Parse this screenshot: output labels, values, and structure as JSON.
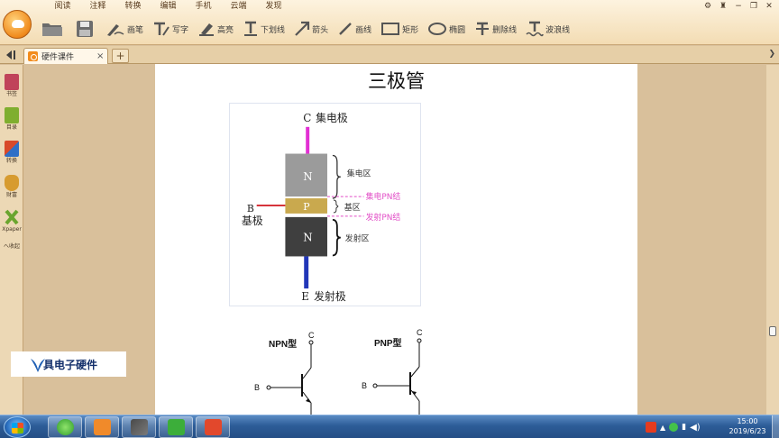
{
  "menu": [
    "阅读",
    "注释",
    "转换",
    "编辑",
    "手机",
    "云端",
    "发现"
  ],
  "toolbar": {
    "pen": "画笔",
    "write": "写字",
    "highlight": "高亮",
    "underline": "下划线",
    "arrow": "箭头",
    "curve": "画线",
    "rectangle": "矩形",
    "ellipse": "椭圆",
    "strikethrough": "删除线",
    "wavyline": "波浪线"
  },
  "tab": {
    "label": "硬件课件"
  },
  "sidebar": {
    "bookmark": "书签",
    "toc": "目录",
    "convert": "转换",
    "wealth": "财富",
    "xpaper": "Xpaper",
    "collapse": "へ收起"
  },
  "document": {
    "title": "三极管",
    "diagram": {
      "collector_letter": "C",
      "collector_label": "集电极",
      "collector_region": "集电区",
      "collector_junction": "集电PN结",
      "base_region": "基区",
      "emitter_junction": "发射PN结",
      "emitter_region": "发射区",
      "base_letter": "B",
      "base_label": "基极",
      "emitter_letter": "E",
      "emitter_label": "发射极",
      "n_top": "N",
      "p_mid": "P",
      "n_bottom": "N"
    },
    "npn": {
      "label": "NPN型",
      "c": "C",
      "b": "B"
    },
    "pnp": {
      "label": "PNP型",
      "c": "C",
      "b": "B"
    }
  },
  "watermark": {
    "text": "具电子硬件"
  },
  "taskbar": {
    "time": "15:00",
    "date": "2019/6/23"
  },
  "colors": {
    "collector_lead": "#e22fd3",
    "emitter_lead": "#2136b8",
    "base_lead": "#d6323a",
    "n_top_fill": "#9b9b9b",
    "p_fill": "#c9a94e",
    "n_bottom_fill": "#3f3f3f",
    "junction_text": "#e24fc7"
  }
}
